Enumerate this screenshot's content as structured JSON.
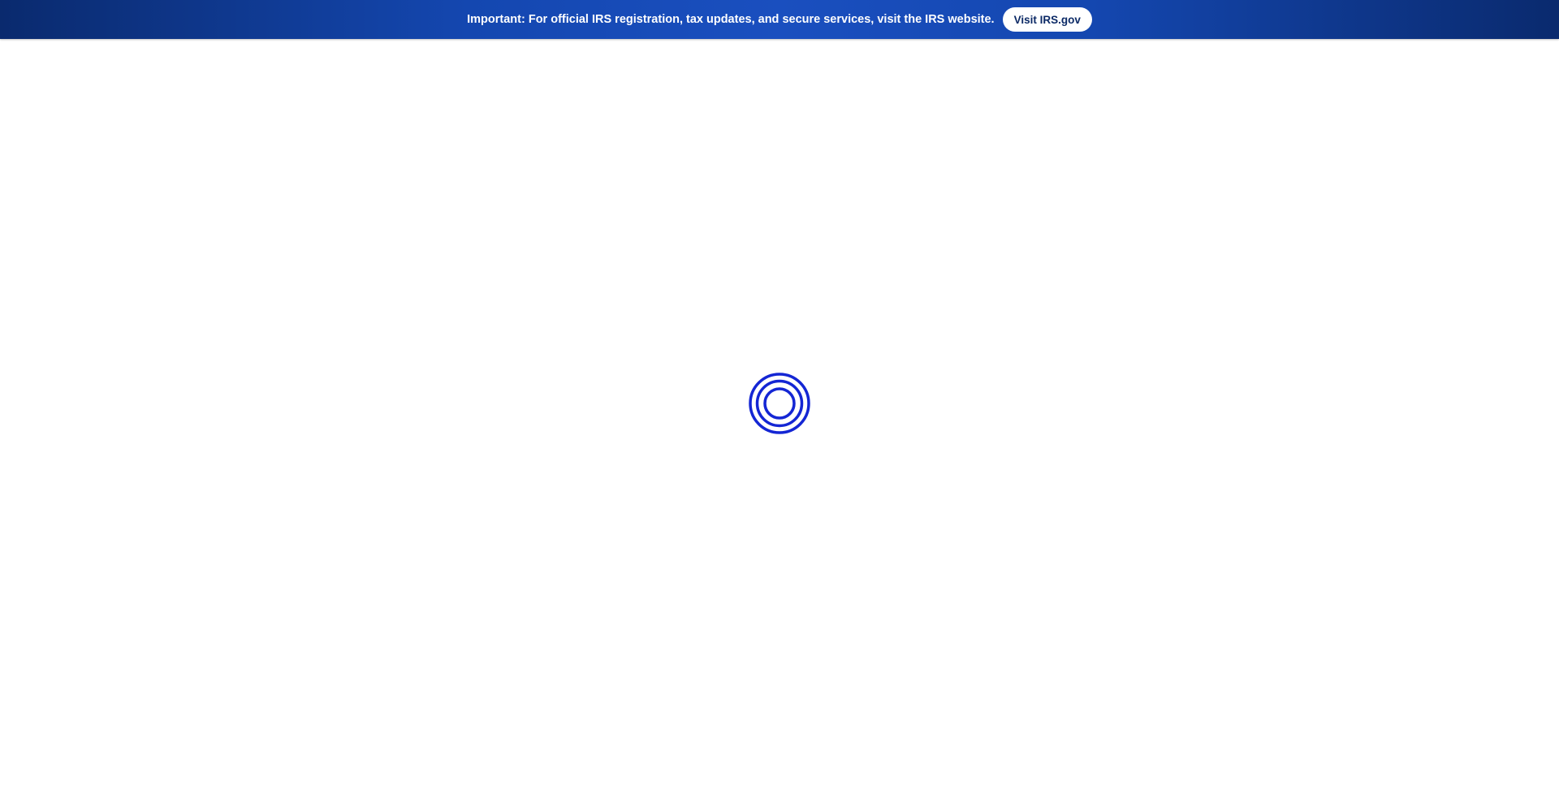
{
  "banner": {
    "message": "Important: For official IRS registration, tax updates, and secure services, visit the IRS website.",
    "button_label": "Visit IRS.gov"
  },
  "loader": {
    "icon": "loading-spinner-icon",
    "color": "#1426d4"
  },
  "colors": {
    "banner_bg": "#1447b0",
    "banner_text": "#ffffff",
    "button_bg": "#ffffff",
    "button_text": "#0c2a66",
    "page_bg": "#ffffff"
  }
}
